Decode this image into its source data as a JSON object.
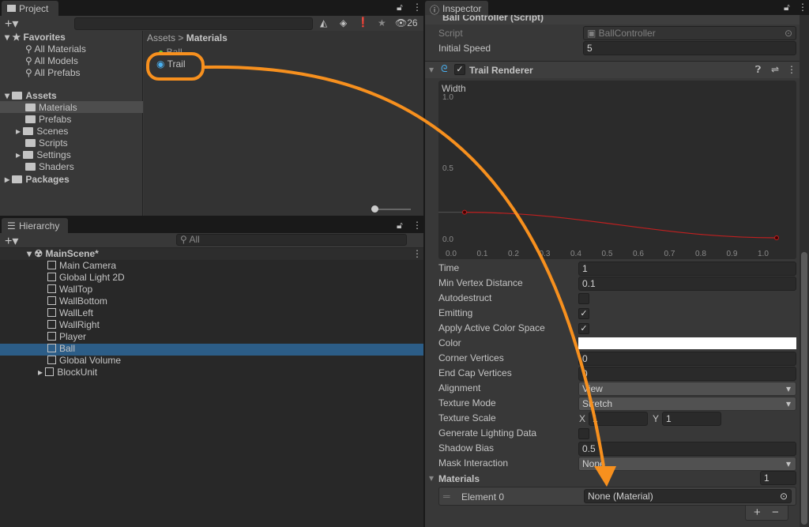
{
  "project": {
    "tab": "Project",
    "search_placeholder": "",
    "hidden_count": "26",
    "favorites": {
      "label": "Favorites",
      "items": [
        "All Materials",
        "All Models",
        "All Prefabs"
      ]
    },
    "assets": {
      "label": "Assets",
      "items": [
        "Materials",
        "Prefabs",
        "Scenes",
        "Scripts",
        "Settings",
        "Shaders"
      ],
      "selected": "Materials"
    },
    "packages": "Packages",
    "breadcrumb": [
      "Assets",
      "Materials"
    ],
    "files": [
      "Ball",
      "Trail"
    ]
  },
  "hierarchy": {
    "tab": "Hierarchy",
    "search_placeholder": "All",
    "scene": "MainScene*",
    "items": [
      "Main Camera",
      "Global Light 2D",
      "WallTop",
      "WallBottom",
      "WallLeft",
      "WallRight",
      "Player",
      "Ball",
      "Global Volume",
      "BlockUnit"
    ],
    "selected": "Ball"
  },
  "inspector": {
    "tab": "Inspector",
    "ball_controller": {
      "title": "Ball Controller (Script)",
      "script_label": "Script",
      "script_value": "BallController",
      "speed_label": "Initial Speed",
      "speed_value": "5"
    },
    "trail": {
      "title": "Trail Renderer",
      "width_curve": {
        "label": "Width",
        "y_ticks": [
          "1.0",
          "0.5",
          "0.0"
        ],
        "x_ticks": [
          "0.0",
          "0.1",
          "0.2",
          "0.3",
          "0.4",
          "0.5",
          "0.6",
          "0.7",
          "0.8",
          "0.9",
          "1.0"
        ],
        "keys": [
          {
            "time": 0,
            "value": 0.18
          },
          {
            "time": 1,
            "value": 0
          }
        ],
        "curve_color": "#c02020"
      },
      "props": {
        "time": {
          "label": "Time",
          "value": "1"
        },
        "min_vertex": {
          "label": "Min Vertex Distance",
          "value": "0.1"
        },
        "autodestruct": {
          "label": "Autodestruct",
          "checked": false
        },
        "emitting": {
          "label": "Emitting",
          "checked": true
        },
        "active_color_space": {
          "label": "Apply Active Color Space",
          "checked": true
        },
        "color": {
          "label": "Color",
          "value": "#ffffff"
        },
        "corner": {
          "label": "Corner Vertices",
          "value": "0"
        },
        "endcap": {
          "label": "End Cap Vertices",
          "value": "0"
        },
        "alignment": {
          "label": "Alignment",
          "value": "View"
        },
        "texture_mode": {
          "label": "Texture Mode",
          "value": "Stretch"
        },
        "texture_scale": {
          "label": "Texture Scale",
          "x_label": "X",
          "x": "1",
          "y_label": "Y",
          "y": "1"
        },
        "lighting": {
          "label": "Generate Lighting Data",
          "checked": false
        },
        "shadow_bias": {
          "label": "Shadow Bias",
          "value": "0.5"
        },
        "mask": {
          "label": "Mask Interaction",
          "value": "None"
        }
      },
      "materials": {
        "label": "Materials",
        "count": "1",
        "element_label": "Element 0",
        "element_value": "None (Material)",
        "add": "+",
        "remove": "−"
      }
    }
  },
  "annotation_color": "#f7901e"
}
